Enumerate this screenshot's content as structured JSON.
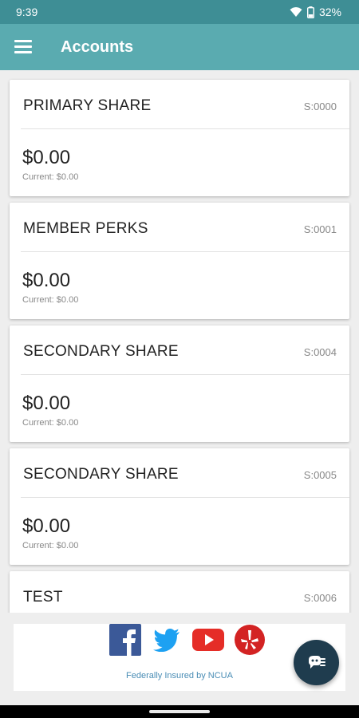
{
  "status_bar": {
    "time": "9:39",
    "battery": "32%"
  },
  "app_bar": {
    "title": "Accounts"
  },
  "accounts": [
    {
      "name": "PRIMARY SHARE",
      "id": "S:0000",
      "balance": "$0.00",
      "current": "Current: $0.00"
    },
    {
      "name": "MEMBER PERKS",
      "id": "S:0001",
      "balance": "$0.00",
      "current": "Current: $0.00"
    },
    {
      "name": "SECONDARY SHARE",
      "id": "S:0004",
      "balance": "$0.00",
      "current": "Current: $0.00"
    },
    {
      "name": "SECONDARY SHARE",
      "id": "S:0005",
      "balance": "$0.00",
      "current": "Current: $0.00"
    },
    {
      "name": "TEST",
      "id": "S:0006",
      "balance": "",
      "current": ""
    }
  ],
  "footer": {
    "icons": [
      "facebook-icon",
      "twitter-icon",
      "youtube-icon",
      "yelp-icon"
    ],
    "insured_text": "Federally Insured by NCUA"
  },
  "colors": {
    "status_bar": "#3e8e95",
    "app_bar": "#5aabb0",
    "fab": "#1f3c4e",
    "ncua_text": "#4a8db5"
  }
}
